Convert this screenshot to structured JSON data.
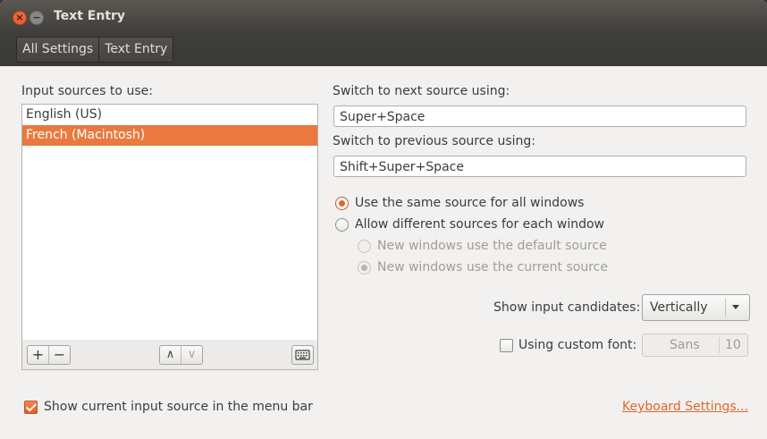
{
  "window": {
    "title": "Text Entry",
    "close_glyph": "×",
    "minimize_glyph": "−"
  },
  "breadcrumb": [
    "All Settings",
    "Text Entry"
  ],
  "input_sources": {
    "label": "Input sources to use:",
    "items": [
      "English (US)",
      "French (Macintosh)"
    ],
    "selected_index": 1
  },
  "list_toolbar": {
    "add": "+",
    "remove": "−",
    "move_up": "∧",
    "move_down": "∨"
  },
  "switch_next": {
    "label": "Switch to next source using:",
    "value": "Super+Space"
  },
  "switch_prev": {
    "label": "Switch to previous source using:",
    "value": "Shift+Super+Space"
  },
  "source_mode": {
    "same_label": "Use the same source for all windows",
    "different_label": "Allow different sources for each window",
    "same_selected": true,
    "sub_default_label": "New windows use the default source",
    "sub_current_label": "New windows use the current source",
    "sub_current_selected": true
  },
  "candidates": {
    "label": "Show input candidates:",
    "value": "Vertically"
  },
  "custom_font": {
    "label": "Using custom font:",
    "checked": false,
    "font_name": "Sans",
    "font_size": "10"
  },
  "show_in_menu_bar": {
    "label": "Show current input source in the menu bar",
    "checked": true
  },
  "keyboard_settings_link": "Keyboard Settings...",
  "colors": {
    "accent": "#e9793f",
    "link": "#e0662d",
    "titlebar": "#3f3e3a"
  }
}
